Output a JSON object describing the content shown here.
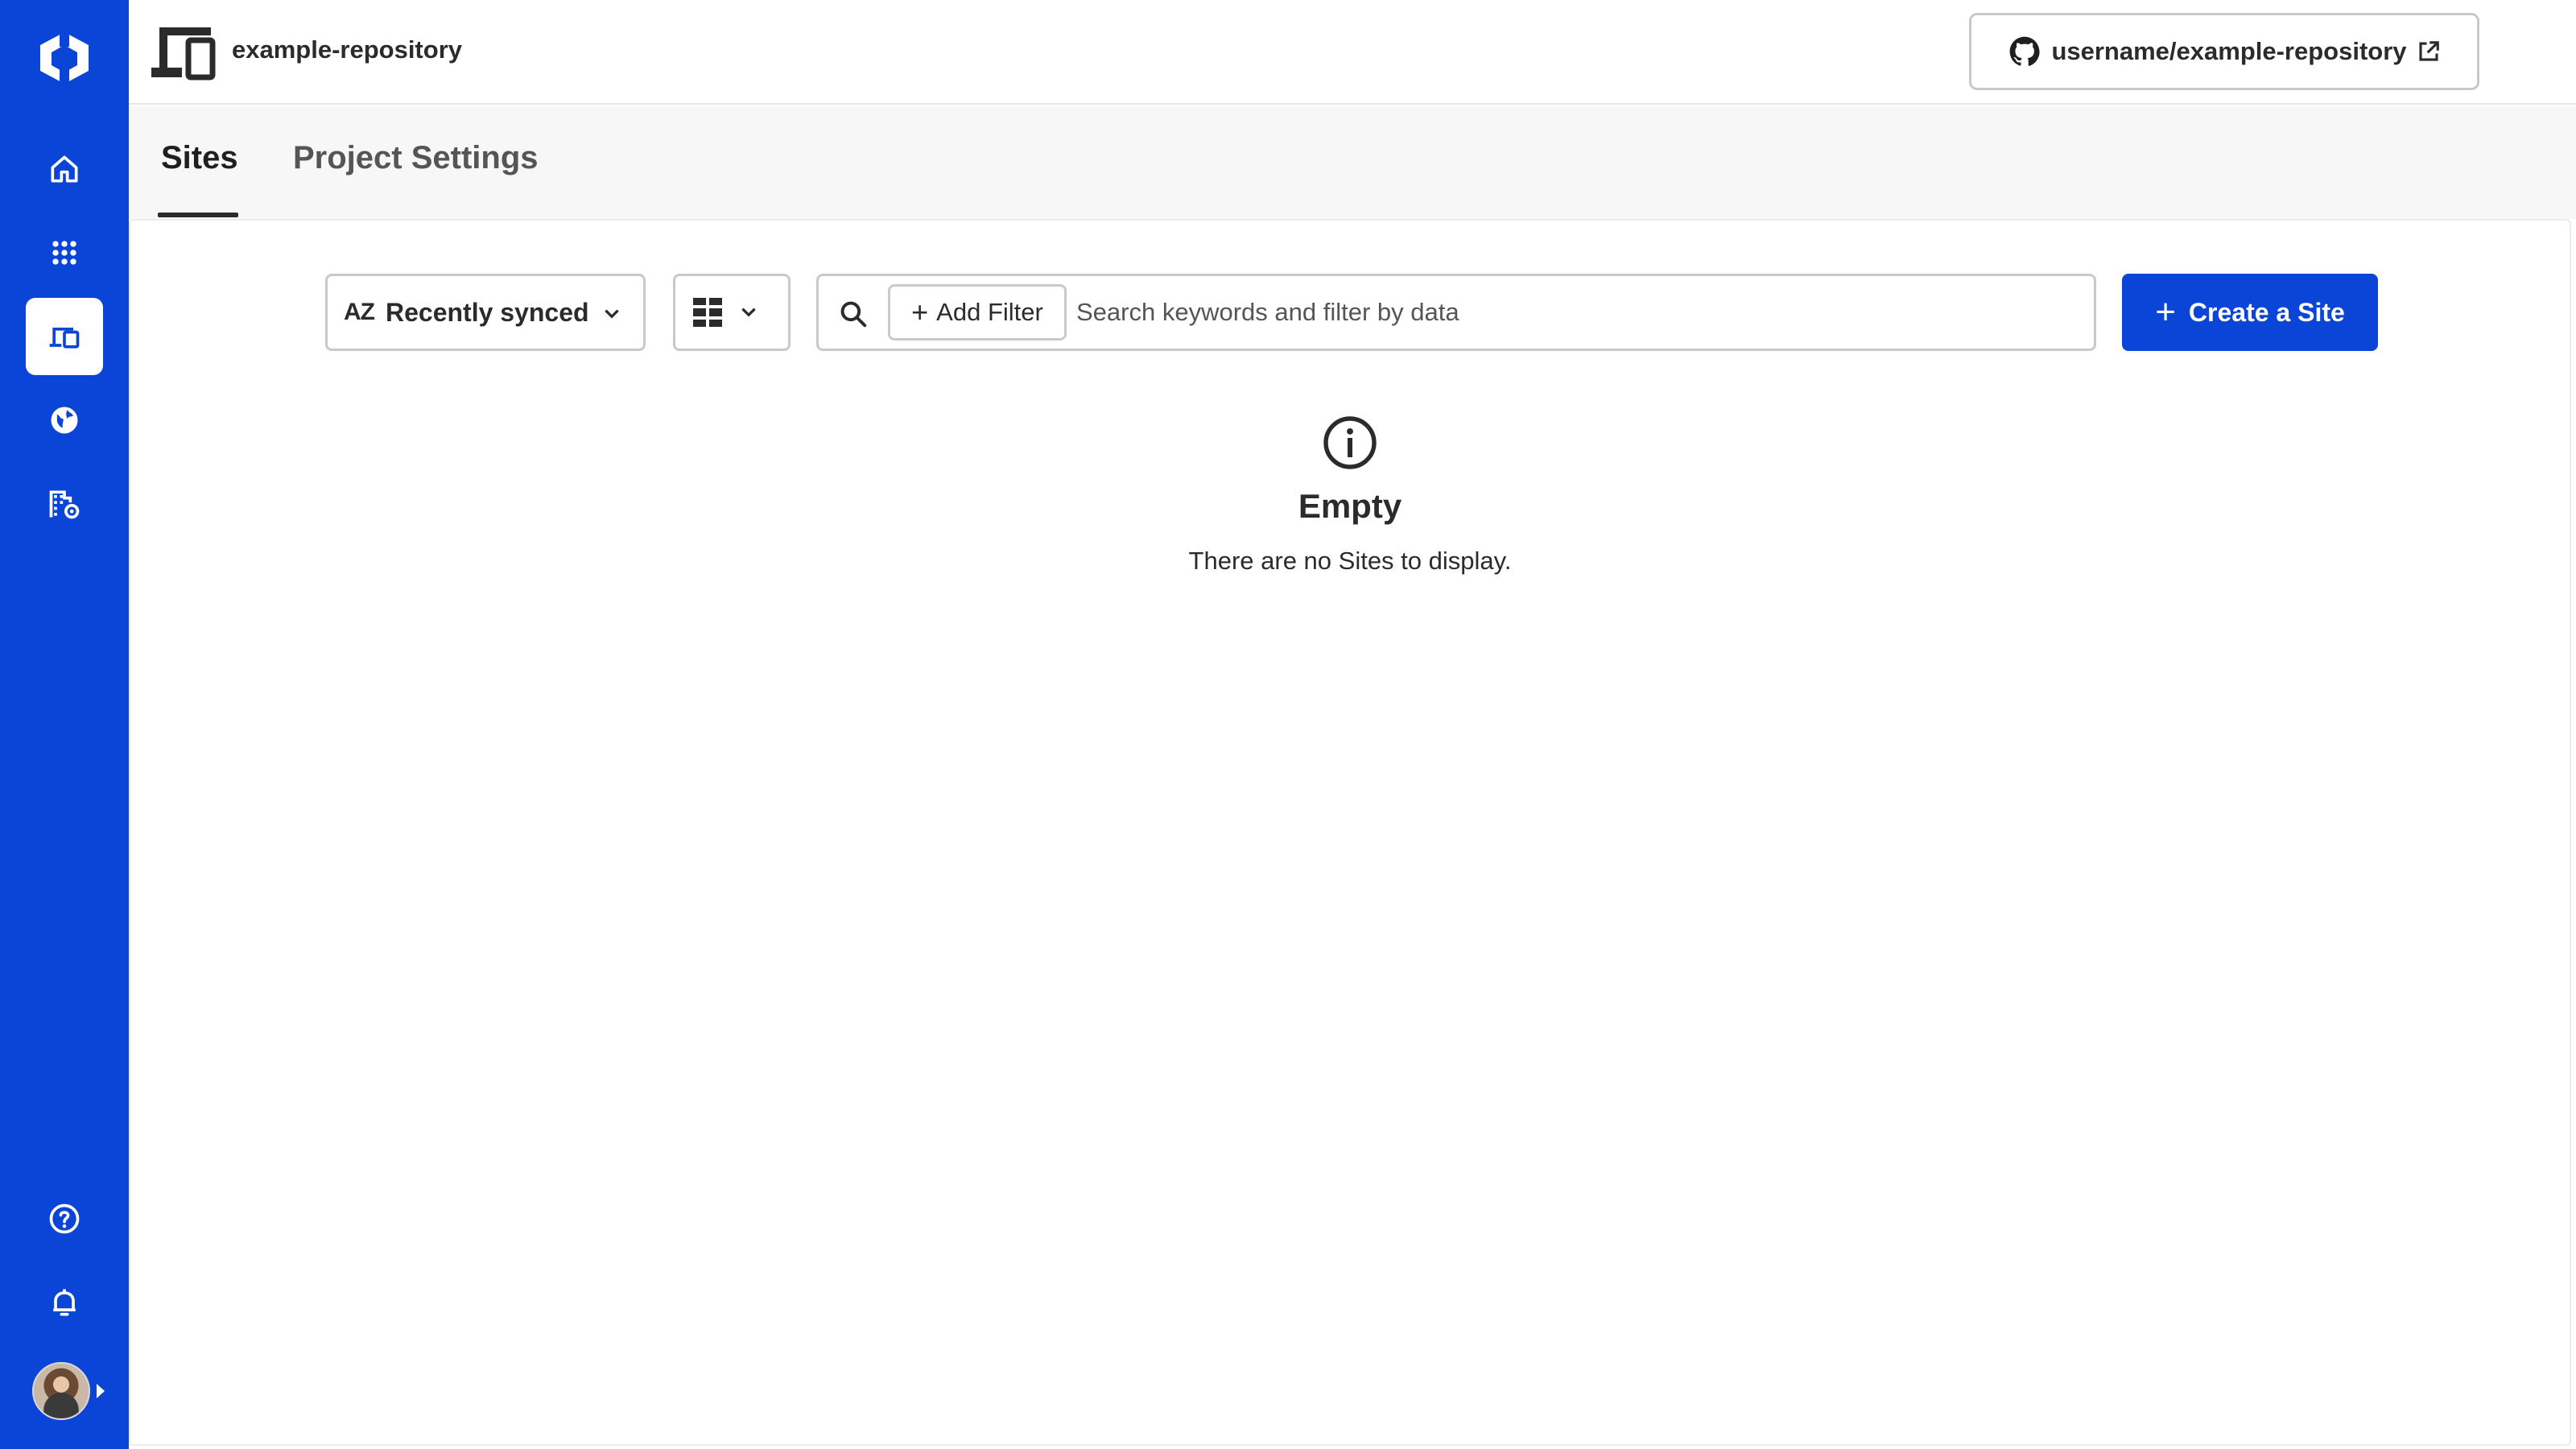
{
  "app": {
    "accent_color": "#0a45d8"
  },
  "sidebar": {
    "logo_icon": "logo-icon",
    "items": [
      {
        "id": "home",
        "icon": "home-icon",
        "active": false
      },
      {
        "id": "apps",
        "icon": "apps-grid-icon",
        "active": false
      },
      {
        "id": "projects",
        "icon": "devices-icon",
        "active": true
      },
      {
        "id": "web",
        "icon": "globe-icon",
        "active": false
      },
      {
        "id": "org",
        "icon": "building-settings-icon",
        "active": false
      }
    ],
    "bottom_items": [
      {
        "id": "help",
        "icon": "help-icon"
      },
      {
        "id": "notifications",
        "icon": "bell-icon"
      }
    ]
  },
  "header": {
    "project_name": "example-repository",
    "repo_link": "username/example-repository"
  },
  "tabs": [
    {
      "label": "Sites",
      "active": true
    },
    {
      "label": "Project Settings",
      "active": false
    }
  ],
  "toolbar": {
    "sort_label": "Recently synced",
    "sort_prefix": "AZ",
    "add_filter_label": "Add Filter",
    "search_placeholder": "Search keywords and filter by data",
    "create_label": "Create a Site"
  },
  "empty_state": {
    "title": "Empty",
    "message": "There are no Sites to display."
  }
}
